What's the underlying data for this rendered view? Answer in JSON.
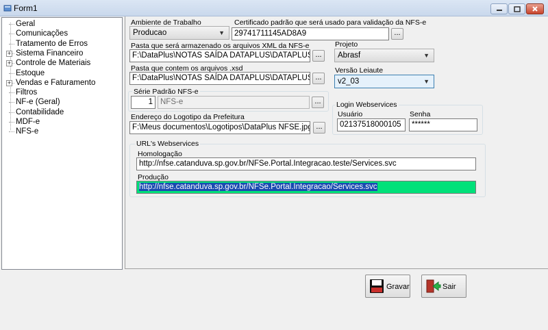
{
  "window": {
    "title": "Form1"
  },
  "tree": {
    "items": [
      {
        "label": "Geral",
        "expandable": false
      },
      {
        "label": "Comunicações",
        "expandable": false
      },
      {
        "label": "Tratamento de Erros",
        "expandable": false
      },
      {
        "label": "Sistema Financeiro",
        "expandable": true
      },
      {
        "label": "Controle de Materiais",
        "expandable": true
      },
      {
        "label": "Estoque",
        "expandable": false
      },
      {
        "label": "Vendas e Faturamento",
        "expandable": true
      },
      {
        "label": "Filtros",
        "expandable": false
      },
      {
        "label": "NF-e (Geral)",
        "expandable": false
      },
      {
        "label": "Contabilidade",
        "expandable": false
      },
      {
        "label": "MDF-e",
        "expandable": false
      },
      {
        "label": "NFS-e",
        "expandable": false
      }
    ]
  },
  "form": {
    "ambiente": {
      "label": "Ambiente de Trabalho",
      "value": "Producao"
    },
    "certificado": {
      "label": "Certificado padrão que será usado para validação da NFS-e",
      "value": "29741711145AD8A9"
    },
    "pasta_xml": {
      "label": "Pasta que será armazenado os arquivos XML da NFS-e",
      "value": "F:\\DataPlus\\NOTAS SAÍDA DATAPLUS\\DATAPLUS\\XI"
    },
    "pasta_xsd": {
      "label": "Pasta que contem os arquivos .xsd",
      "value": "F:\\DataPlus\\NOTAS SAÍDA DATAPLUS\\DATAPLUS\\sc"
    },
    "projeto": {
      "label": "Projeto",
      "value": "Abrasf"
    },
    "versao": {
      "label": "Versão Leiaute",
      "value": "v2_03"
    },
    "serie": {
      "label": "Série Padrão NFS-e",
      "number": "1",
      "value": "NFS-e"
    },
    "logotipo": {
      "label": "Endereço do Logotipo da Prefeitura",
      "value": "F:\\Meus documentos\\Logotipos\\DataPlus NFSE.jpg"
    },
    "login": {
      "title": "Login Webservices",
      "usuario_label": "Usuário",
      "usuario_value": "02137518000105",
      "senha_label": "Senha",
      "senha_value": "******"
    },
    "urls": {
      "title": "URL's Webservices",
      "homologacao_label": "Homologação",
      "homologacao_value": "http://nfse.catanduva.sp.gov.br/NFSe.Portal.Integracao.teste/Services.svc",
      "producao_label": "Produção",
      "producao_value": "http://nfse.catanduva.sp.gov.br/NFSe.Portal.Integracao/Services.svc"
    },
    "dots": "..."
  },
  "buttons": {
    "gravar": "Gravar",
    "sair": "Sair"
  },
  "colors": {
    "selection_bg": "#00e17a",
    "highlight": "#1a4bb0"
  }
}
